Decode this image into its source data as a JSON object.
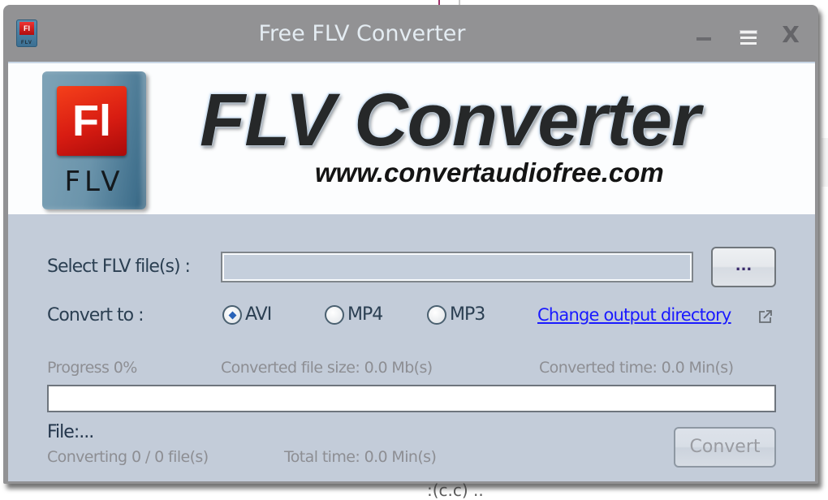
{
  "window": {
    "title": "Free FLV Converter",
    "app_icon": "flv-app-icon",
    "controls": {
      "minimize_icon": "minimize-icon",
      "maximize_icon": "maximize-icon",
      "close_icon": "close-icon",
      "close_glyph": "X"
    }
  },
  "banner": {
    "logo_symbol": "Fl",
    "logo_caption": "FLV",
    "title": "FLV Converter",
    "url": "www.convertaudiofree.com"
  },
  "form": {
    "select_label": "Select FLV file(s) :",
    "file_input_value": "",
    "browse_label": "...",
    "convert_to_label": "Convert to :",
    "formats": [
      {
        "label": "AVI",
        "checked": true
      },
      {
        "label": "MP4",
        "checked": false
      },
      {
        "label": "MP3",
        "checked": false
      }
    ],
    "change_dir_link": "Change output directory",
    "external_link_icon": "external-link-icon"
  },
  "status": {
    "progress_label": "Progress 0%",
    "progress_value": 0,
    "converted_size": "Converted file size: 0.0 Mb(s)",
    "converted_time": "Converted time: 0.0 Min(s)",
    "file": "File:...",
    "converting_count": "Converting 0 / 0 file(s)",
    "total_time": "Total time: 0.0 Min(s)"
  },
  "actions": {
    "convert_label": "Convert",
    "convert_enabled": false
  }
}
